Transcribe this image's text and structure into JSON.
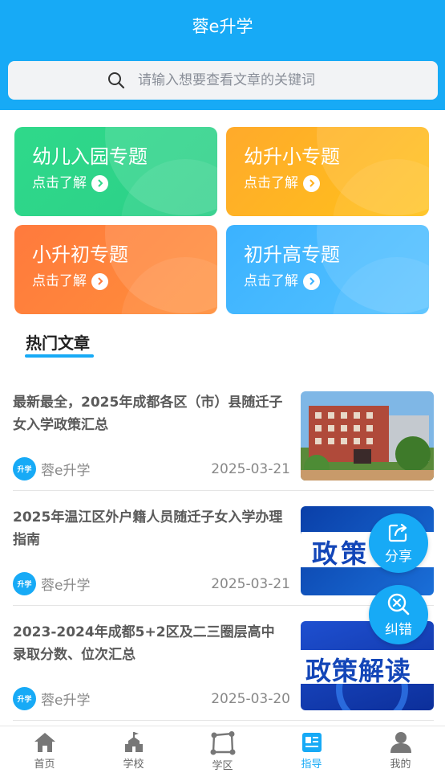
{
  "header": {
    "title": "蓉e升学"
  },
  "search": {
    "placeholder": "请输入想要查看文章的关键词"
  },
  "cards": [
    {
      "title": "幼儿入园专题",
      "sub": "点击了解"
    },
    {
      "title": "幼升小专题",
      "sub": "点击了解"
    },
    {
      "title": "小升初专题",
      "sub": "点击了解"
    },
    {
      "title": "初升高专题",
      "sub": "点击了解"
    }
  ],
  "section": {
    "title": "热门文章"
  },
  "articles": [
    {
      "title": "最新最全，2025年成都各区（市）县随迁子女入学政策汇总",
      "source": "蓉e升学",
      "date": "2025-03-21",
      "thumb_text": ""
    },
    {
      "title": "2025年温江区外户籍人员随迁子女入学办理指南",
      "source": "蓉e升学",
      "date": "2025-03-21",
      "thumb_text": "政策"
    },
    {
      "title": "2023-2024年成都5+2区及二三圈层高中录取分数、位次汇总",
      "source": "蓉e升学",
      "date": "2025-03-20",
      "thumb_text": "政策解读"
    }
  ],
  "logo_text": "升学",
  "floating": {
    "share": "分享",
    "correct": "纠错"
  },
  "tabbar": [
    {
      "label": "首页",
      "icon": "home-icon"
    },
    {
      "label": "学校",
      "icon": "school-icon"
    },
    {
      "label": "学区",
      "icon": "district-icon"
    },
    {
      "label": "指导",
      "icon": "guide-icon",
      "active": true
    },
    {
      "label": "我的",
      "icon": "profile-icon"
    }
  ],
  "colors": {
    "primary": "#17aaf6",
    "green": "#2fd98a",
    "orange": "#ffb020",
    "red": "#ff7a3d",
    "blue": "#3bb2ff"
  }
}
